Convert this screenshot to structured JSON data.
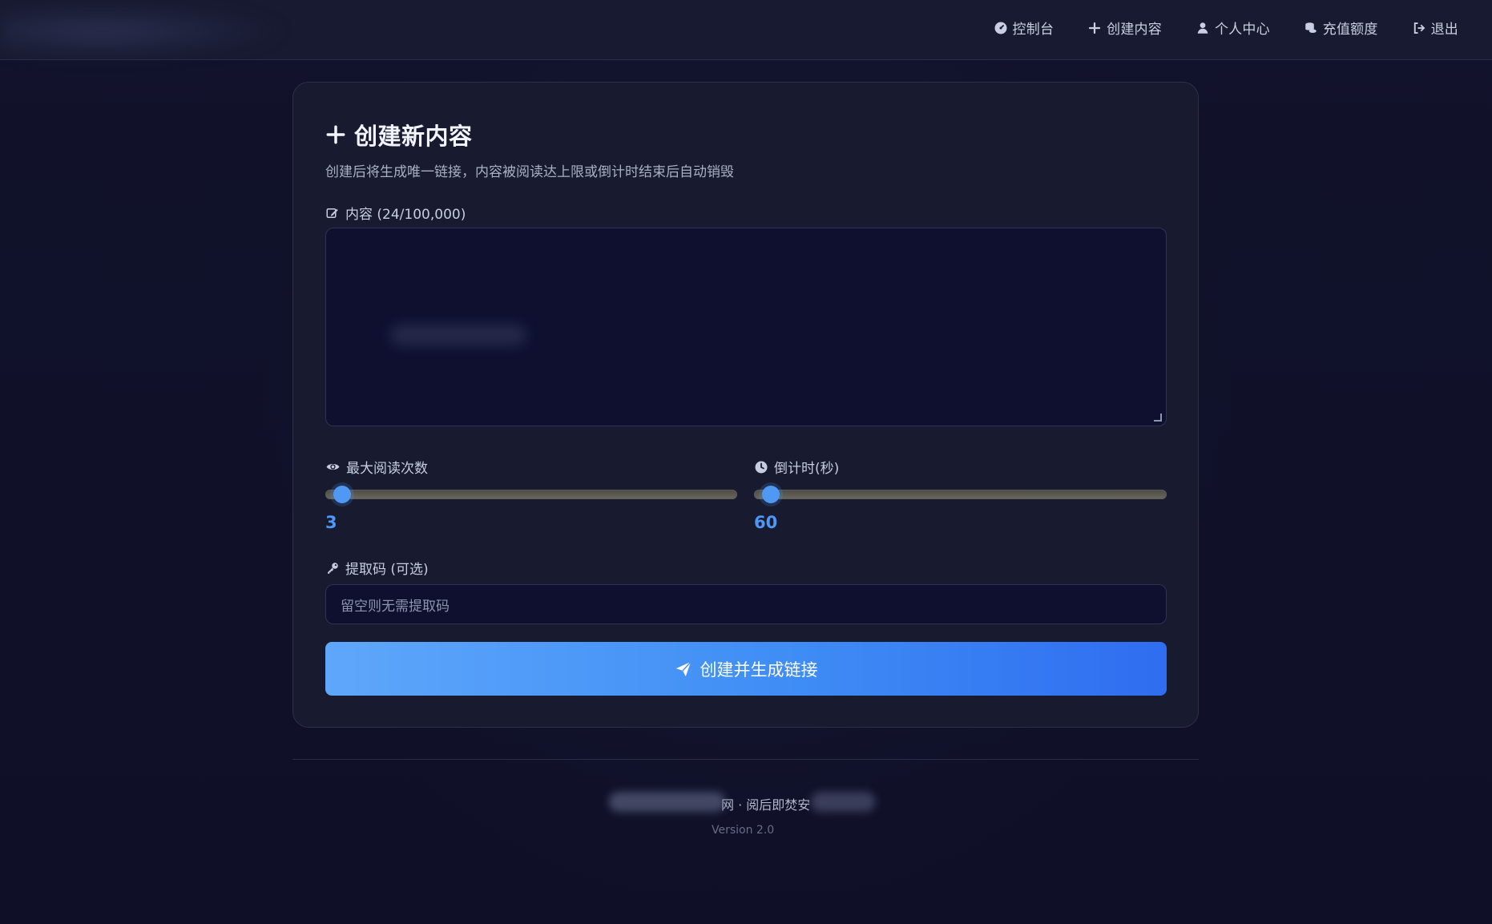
{
  "nav": {
    "items": [
      {
        "label": "控制台",
        "icon": "dashboard-icon"
      },
      {
        "label": "创建内容",
        "icon": "plus-icon"
      },
      {
        "label": "个人中心",
        "icon": "user-icon"
      },
      {
        "label": "充值额度",
        "icon": "coins-icon"
      },
      {
        "label": "退出",
        "icon": "sign-out-icon"
      }
    ]
  },
  "card": {
    "title": "创建新内容",
    "subtitle": "创建后将生成唯一链接，内容被阅读达上限或倒计时结束后自动销毁",
    "content_label": "内容 (24/100,000)",
    "content_value": "",
    "max_reads_label": "最大阅读次数",
    "max_reads_value": "3",
    "max_reads_fraction": 0.02,
    "countdown_label": "倒计时(秒)",
    "countdown_value": "60",
    "countdown_fraction": 0.02,
    "code_label": "提取码 (可选)",
    "code_placeholder": "留空则无需提取码",
    "submit_label": "创建并生成链接"
  },
  "footer": {
    "line": "网 · 阅后即焚安",
    "version": "Version 2.0"
  },
  "colors": {
    "accent": "#4e98f5",
    "button_start": "#5ea7fb",
    "button_end": "#2f6df0",
    "background": "#10112a",
    "card": "#181a2f"
  }
}
